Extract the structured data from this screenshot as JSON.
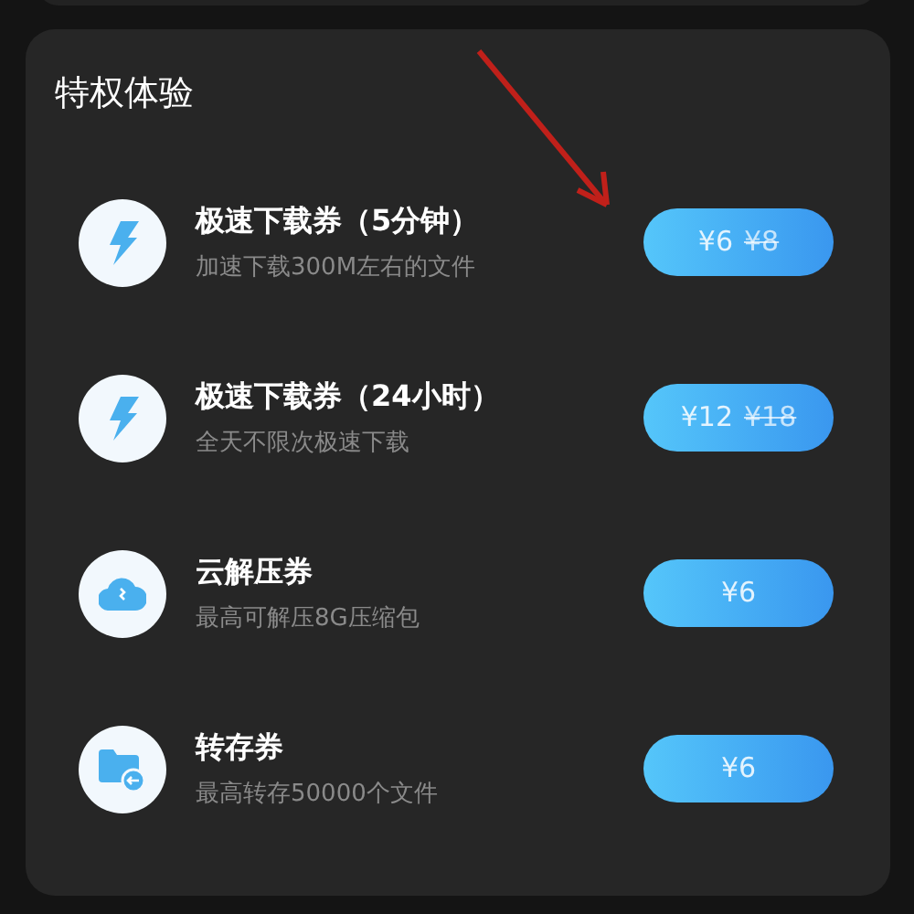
{
  "section": {
    "title": "特权体验"
  },
  "items": [
    {
      "kind": "bolt",
      "title": "极速下载券（5分钟）",
      "description": "加速下载300M左右的文件",
      "price": "¥6",
      "original_price": "¥8"
    },
    {
      "kind": "bolt",
      "title": "极速下载券（24小时）",
      "description": "全天不限次极速下载",
      "price": "¥12",
      "original_price": "¥18"
    },
    {
      "kind": "cloud",
      "title": "云解压券",
      "description": "最高可解压8G压缩包",
      "price": "¥6"
    },
    {
      "kind": "folder",
      "title": "转存券",
      "description": "最高转存50000个文件",
      "price": "¥6"
    }
  ]
}
